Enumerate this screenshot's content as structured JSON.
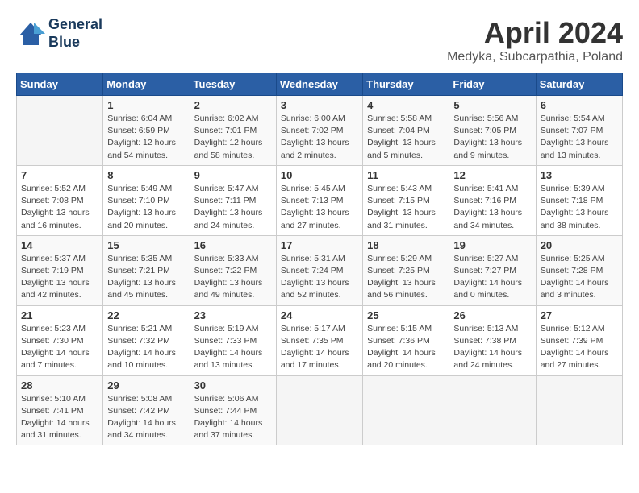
{
  "header": {
    "logo_line1": "General",
    "logo_line2": "Blue",
    "month": "April 2024",
    "location": "Medyka, Subcarpathia, Poland"
  },
  "weekdays": [
    "Sunday",
    "Monday",
    "Tuesday",
    "Wednesday",
    "Thursday",
    "Friday",
    "Saturday"
  ],
  "weeks": [
    [
      {
        "day": "",
        "info": ""
      },
      {
        "day": "1",
        "info": "Sunrise: 6:04 AM\nSunset: 6:59 PM\nDaylight: 12 hours\nand 54 minutes."
      },
      {
        "day": "2",
        "info": "Sunrise: 6:02 AM\nSunset: 7:01 PM\nDaylight: 12 hours\nand 58 minutes."
      },
      {
        "day": "3",
        "info": "Sunrise: 6:00 AM\nSunset: 7:02 PM\nDaylight: 13 hours\nand 2 minutes."
      },
      {
        "day": "4",
        "info": "Sunrise: 5:58 AM\nSunset: 7:04 PM\nDaylight: 13 hours\nand 5 minutes."
      },
      {
        "day": "5",
        "info": "Sunrise: 5:56 AM\nSunset: 7:05 PM\nDaylight: 13 hours\nand 9 minutes."
      },
      {
        "day": "6",
        "info": "Sunrise: 5:54 AM\nSunset: 7:07 PM\nDaylight: 13 hours\nand 13 minutes."
      }
    ],
    [
      {
        "day": "7",
        "info": "Sunrise: 5:52 AM\nSunset: 7:08 PM\nDaylight: 13 hours\nand 16 minutes."
      },
      {
        "day": "8",
        "info": "Sunrise: 5:49 AM\nSunset: 7:10 PM\nDaylight: 13 hours\nand 20 minutes."
      },
      {
        "day": "9",
        "info": "Sunrise: 5:47 AM\nSunset: 7:11 PM\nDaylight: 13 hours\nand 24 minutes."
      },
      {
        "day": "10",
        "info": "Sunrise: 5:45 AM\nSunset: 7:13 PM\nDaylight: 13 hours\nand 27 minutes."
      },
      {
        "day": "11",
        "info": "Sunrise: 5:43 AM\nSunset: 7:15 PM\nDaylight: 13 hours\nand 31 minutes."
      },
      {
        "day": "12",
        "info": "Sunrise: 5:41 AM\nSunset: 7:16 PM\nDaylight: 13 hours\nand 34 minutes."
      },
      {
        "day": "13",
        "info": "Sunrise: 5:39 AM\nSunset: 7:18 PM\nDaylight: 13 hours\nand 38 minutes."
      }
    ],
    [
      {
        "day": "14",
        "info": "Sunrise: 5:37 AM\nSunset: 7:19 PM\nDaylight: 13 hours\nand 42 minutes."
      },
      {
        "day": "15",
        "info": "Sunrise: 5:35 AM\nSunset: 7:21 PM\nDaylight: 13 hours\nand 45 minutes."
      },
      {
        "day": "16",
        "info": "Sunrise: 5:33 AM\nSunset: 7:22 PM\nDaylight: 13 hours\nand 49 minutes."
      },
      {
        "day": "17",
        "info": "Sunrise: 5:31 AM\nSunset: 7:24 PM\nDaylight: 13 hours\nand 52 minutes."
      },
      {
        "day": "18",
        "info": "Sunrise: 5:29 AM\nSunset: 7:25 PM\nDaylight: 13 hours\nand 56 minutes."
      },
      {
        "day": "19",
        "info": "Sunrise: 5:27 AM\nSunset: 7:27 PM\nDaylight: 14 hours\nand 0 minutes."
      },
      {
        "day": "20",
        "info": "Sunrise: 5:25 AM\nSunset: 7:28 PM\nDaylight: 14 hours\nand 3 minutes."
      }
    ],
    [
      {
        "day": "21",
        "info": "Sunrise: 5:23 AM\nSunset: 7:30 PM\nDaylight: 14 hours\nand 7 minutes."
      },
      {
        "day": "22",
        "info": "Sunrise: 5:21 AM\nSunset: 7:32 PM\nDaylight: 14 hours\nand 10 minutes."
      },
      {
        "day": "23",
        "info": "Sunrise: 5:19 AM\nSunset: 7:33 PM\nDaylight: 14 hours\nand 13 minutes."
      },
      {
        "day": "24",
        "info": "Sunrise: 5:17 AM\nSunset: 7:35 PM\nDaylight: 14 hours\nand 17 minutes."
      },
      {
        "day": "25",
        "info": "Sunrise: 5:15 AM\nSunset: 7:36 PM\nDaylight: 14 hours\nand 20 minutes."
      },
      {
        "day": "26",
        "info": "Sunrise: 5:13 AM\nSunset: 7:38 PM\nDaylight: 14 hours\nand 24 minutes."
      },
      {
        "day": "27",
        "info": "Sunrise: 5:12 AM\nSunset: 7:39 PM\nDaylight: 14 hours\nand 27 minutes."
      }
    ],
    [
      {
        "day": "28",
        "info": "Sunrise: 5:10 AM\nSunset: 7:41 PM\nDaylight: 14 hours\nand 31 minutes."
      },
      {
        "day": "29",
        "info": "Sunrise: 5:08 AM\nSunset: 7:42 PM\nDaylight: 14 hours\nand 34 minutes."
      },
      {
        "day": "30",
        "info": "Sunrise: 5:06 AM\nSunset: 7:44 PM\nDaylight: 14 hours\nand 37 minutes."
      },
      {
        "day": "",
        "info": ""
      },
      {
        "day": "",
        "info": ""
      },
      {
        "day": "",
        "info": ""
      },
      {
        "day": "",
        "info": ""
      }
    ]
  ]
}
